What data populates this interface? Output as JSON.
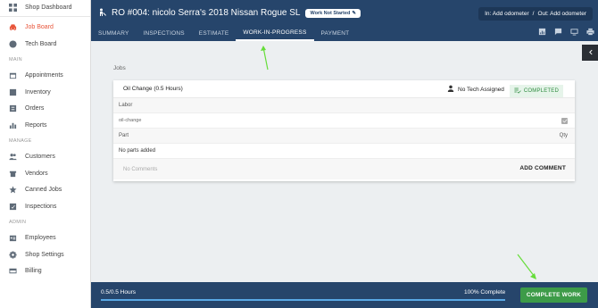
{
  "sidebar": {
    "top_label": "Shop Dashboard",
    "items_top": [
      {
        "label": "Job Board",
        "icon": "car-icon",
        "active": true
      },
      {
        "label": "Tech Board",
        "icon": "gauge-icon",
        "active": false
      }
    ],
    "section_main": "MAIN",
    "items_main": [
      {
        "label": "Appointments",
        "icon": "calendar-icon"
      },
      {
        "label": "Inventory",
        "icon": "inventory-icon"
      },
      {
        "label": "Orders",
        "icon": "orders-icon"
      },
      {
        "label": "Reports",
        "icon": "reports-icon"
      }
    ],
    "section_manage": "MANAGE",
    "items_manage": [
      {
        "label": "Customers",
        "icon": "customers-icon"
      },
      {
        "label": "Vendors",
        "icon": "vendors-icon"
      },
      {
        "label": "Canned Jobs",
        "icon": "star-icon"
      },
      {
        "label": "Inspections",
        "icon": "inspections-icon"
      }
    ],
    "section_admin": "ADMIN",
    "items_admin": [
      {
        "label": "Employees",
        "icon": "employees-icon"
      },
      {
        "label": "Shop Settings",
        "icon": "gear-icon"
      },
      {
        "label": "Billing",
        "icon": "credit-card-icon"
      }
    ]
  },
  "header": {
    "title": "RO #004: nicolo Serra's 2018 Nissan Rogue SL",
    "status": "Work Not Started",
    "odometer_in": "In: Add odometer",
    "odometer_separator": "/",
    "odometer_out": "Out: Add odometer",
    "tabs": [
      "SUMMARY",
      "INSPECTIONS",
      "ESTIMATE",
      "WORK-IN-PROGRESS",
      "PAYMENT"
    ],
    "active_tab": "WORK-IN-PROGRESS"
  },
  "main": {
    "jobs_label": "Jobs",
    "job": {
      "title": "Oil Change (0.5 Hours)",
      "tech": "No Tech Assigned",
      "status": "COMPLETED",
      "labor_header": "Labor",
      "labor_item": "oil-change",
      "part_header": "Part",
      "qty_header": "Qty",
      "parts_empty": "No parts added",
      "comments_empty": "No Comments",
      "add_comment": "ADD COMMENT"
    }
  },
  "bottom": {
    "hours": "0.5/0.5 Hours",
    "percent_label": "100% Complete",
    "progress": 1.0,
    "complete_button": "COMPLETE WORK"
  },
  "colors": {
    "header_bg": "#26456b",
    "active_accent": "#e8553a",
    "complete_green": "#3d9b48",
    "arrow_green": "#66dd3a"
  }
}
